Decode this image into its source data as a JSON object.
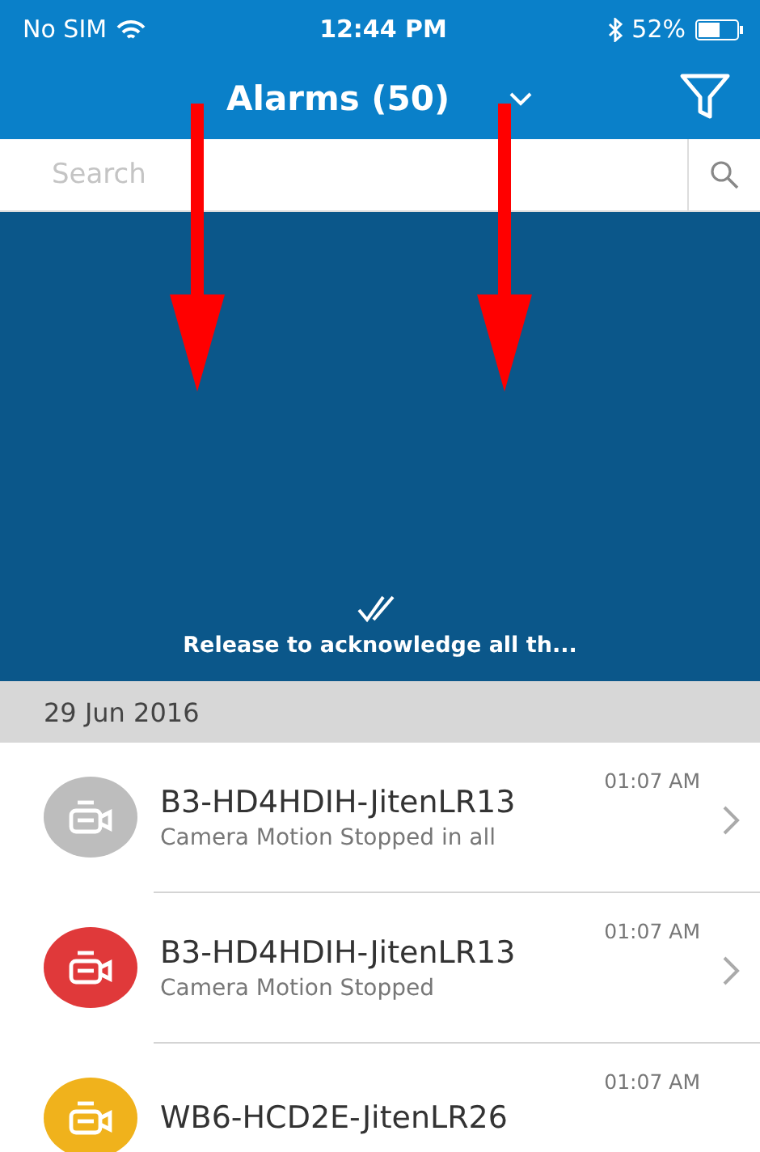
{
  "status_bar": {
    "carrier": "No SIM",
    "time": "12:44 PM",
    "battery": "52%"
  },
  "header": {
    "title": "Alarms (50)"
  },
  "search": {
    "placeholder": "Search"
  },
  "pull_panel": {
    "message": "Release to acknowledge all th..."
  },
  "date_header": "29 Jun 2016",
  "alarms": [
    {
      "title": "B3-HD4HDIH-JitenLR13",
      "subtitle": "Camera Motion Stopped in all",
      "time": "01:07 AM",
      "color": "#bdbdbd"
    },
    {
      "title": "B3-HD4HDIH-JitenLR13",
      "subtitle": "Camera Motion Stopped",
      "time": "01:07 AM",
      "color": "#e0393a"
    },
    {
      "title": "WB6-HCD2E-JitenLR26",
      "time": "01:07 AM",
      "color": "#f0b21c"
    }
  ]
}
